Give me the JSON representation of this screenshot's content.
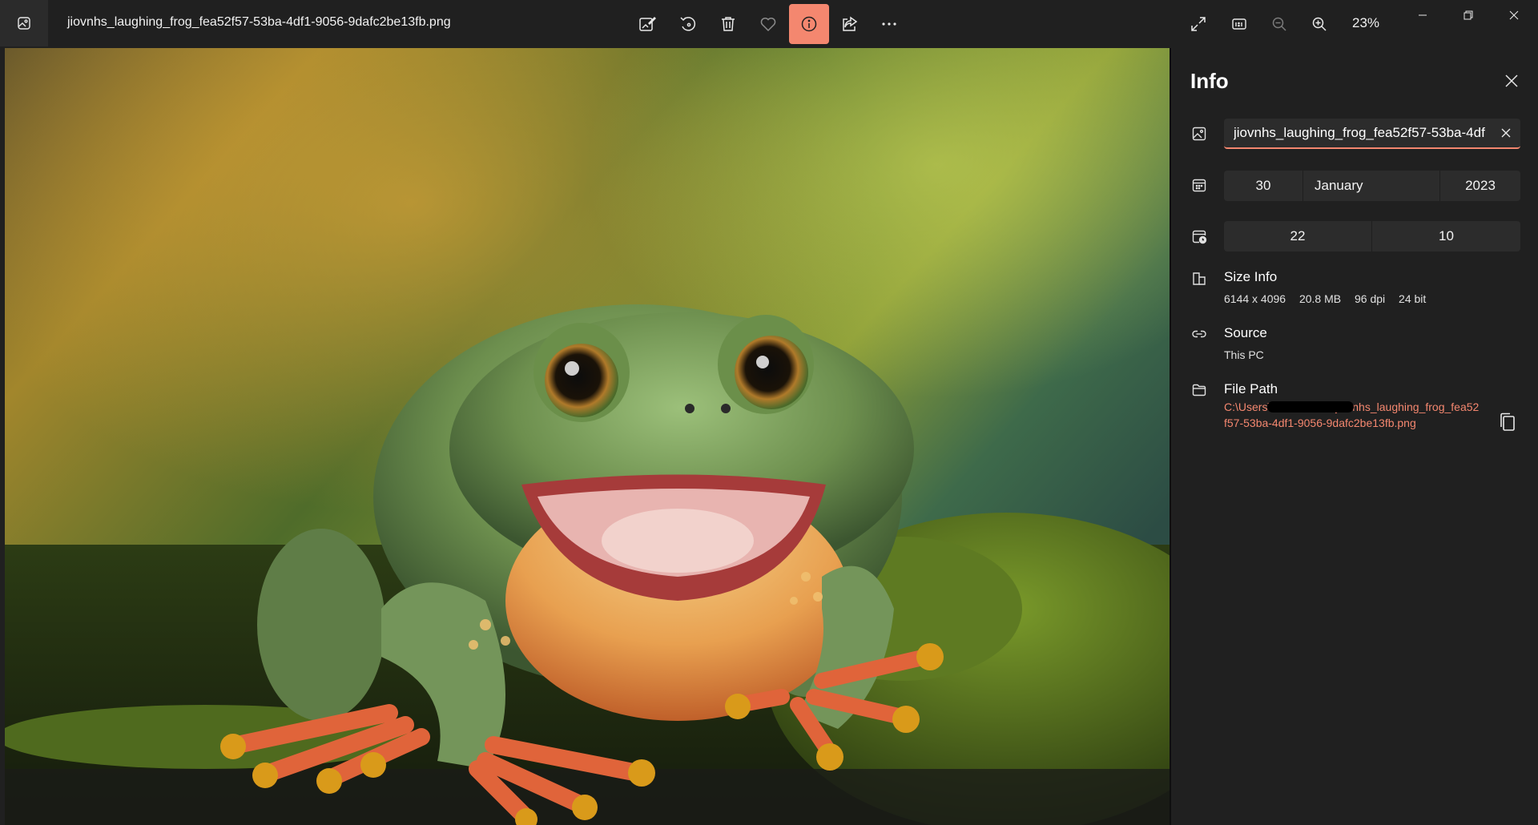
{
  "window": {
    "file_name": "jiovnhs_laughing_frog_fea52f57-53ba-4df1-9056-9dafc2be13fb.png",
    "zoom": "23%"
  },
  "toolbar": {
    "buttons": [
      "edit-image",
      "rotate",
      "delete",
      "favorite",
      "file-info",
      "share",
      "see-more"
    ],
    "active_button": "file-info",
    "accent_color": "#f4876f"
  },
  "view_controls": [
    "full-screen",
    "actual-size",
    "zoom-out",
    "zoom-in"
  ],
  "window_controls": [
    "minimize",
    "restore",
    "close"
  ],
  "info_panel": {
    "title": "Info",
    "file_name_value": "jiovnhs_laughing_frog_fea52f57-53ba-4df1-9056-9dafc2be13fb.png",
    "date": {
      "day": "30",
      "month": "January",
      "year": "2023"
    },
    "time": {
      "hour": "22",
      "minute": "10"
    },
    "size_info": {
      "label": "Size Info",
      "dimensions": "6144 x 4096",
      "file_size": "20.8 MB",
      "dpi": "96 dpi",
      "bit_depth": "24 bit"
    },
    "source": {
      "label": "Source",
      "value": "This PC"
    },
    "file_path": {
      "label": "File Path",
      "value": "C:\\Users\\                    \\Downloads\\jiovnhs_laughing_frog_fea52f57-53ba-4df1-9056-9dafc2be13fb.png"
    }
  }
}
